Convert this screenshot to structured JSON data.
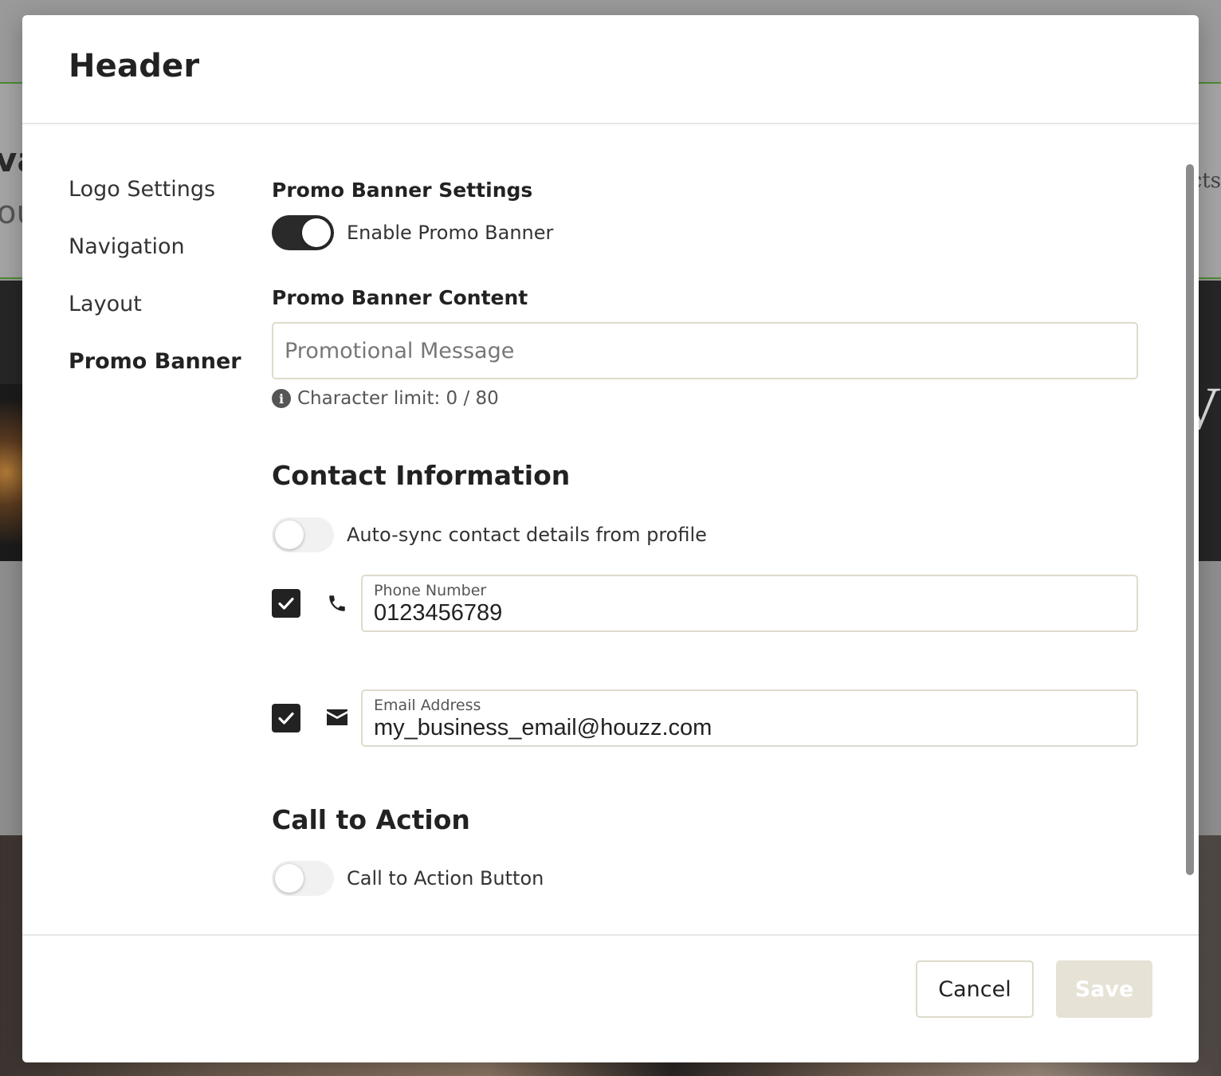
{
  "background_page": {
    "fragment_left_1": "va",
    "fragment_left_2": "ou",
    "fragment_right_1": "cts",
    "fragment_right_2": "V"
  },
  "modal": {
    "title": "Header",
    "nav": [
      {
        "label": "Logo Settings",
        "active": false
      },
      {
        "label": "Navigation",
        "active": false
      },
      {
        "label": "Layout",
        "active": false
      },
      {
        "label": "Promo Banner",
        "active": true
      }
    ],
    "promo": {
      "settings_label": "Promo Banner Settings",
      "enable_label": "Enable Promo Banner",
      "enabled": true,
      "content_label": "Promo Banner Content",
      "message_placeholder": "Promotional Message",
      "message_value": "",
      "char_limit_text": "Character limit: 0 / 80"
    },
    "contact": {
      "heading": "Contact Information",
      "auto_sync_label": "Auto-sync contact details from profile",
      "auto_sync_enabled": false,
      "phone": {
        "label": "Phone Number",
        "value": "0123456789",
        "checked": true,
        "icon": "phone-icon"
      },
      "email": {
        "label": "Email Address",
        "value": "my_business_email@houzz.com",
        "checked": true,
        "icon": "envelope-icon"
      }
    },
    "cta": {
      "heading": "Call to Action",
      "button_label": "Call to Action Button",
      "enabled": false
    },
    "footer": {
      "cancel_label": "Cancel",
      "save_label": "Save"
    },
    "colors": {
      "accent_dark": "#2a2a2a",
      "input_border": "#dedbcc",
      "save_disabled_bg": "#e6e2d6",
      "bg_green_line": "#4e8a34"
    }
  }
}
